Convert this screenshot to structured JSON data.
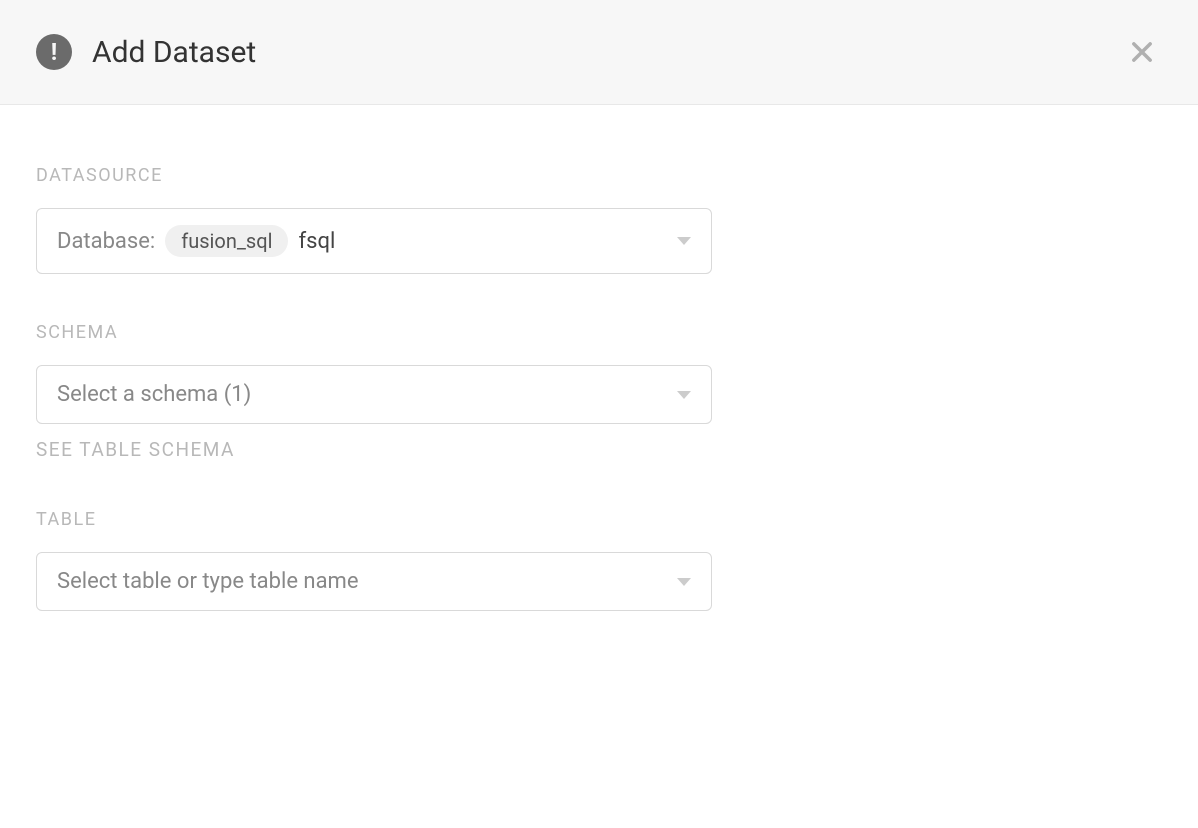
{
  "header": {
    "title": "Add Dataset"
  },
  "datasource": {
    "label": "DATASOURCE",
    "prefix": "Database:",
    "chip": "fusion_sql",
    "value": "fsql"
  },
  "schema": {
    "label": "SCHEMA",
    "placeholder": "Select a schema (1)",
    "helper": "SEE TABLE SCHEMA"
  },
  "table": {
    "label": "TABLE",
    "placeholder": "Select table or type table name"
  }
}
